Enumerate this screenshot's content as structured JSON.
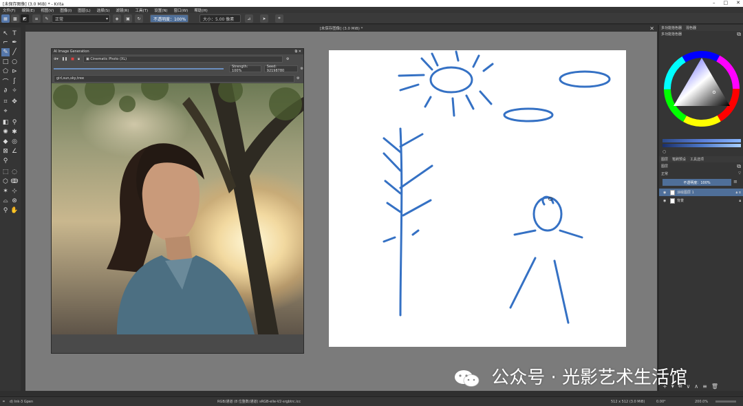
{
  "window": {
    "title": "[未保存图像] (3.0 MiB) * - Krita",
    "controls": [
      "–",
      "□",
      "✕"
    ]
  },
  "menubar": [
    "文件(F)",
    "编辑(E)",
    "视图(V)",
    "图像(I)",
    "图层(L)",
    "选择(S)",
    "滤镜(R)",
    "工具(T)",
    "设置(N)",
    "窗口(W)",
    "帮助(H)"
  ],
  "toolbar": {
    "blend_mode": "正常",
    "opacity": "不透明度：100%",
    "size": "大小：5.00 像素"
  },
  "document_tab": "[未保存图像] (3.0 MiB) *",
  "ai_panel": {
    "title": "AI Image Generation",
    "style": "Cinematic Photo (XL)",
    "strength": "Strength: 100%",
    "seed": "Seed: 92198780",
    "prompt": "girl,sun,sky,tree"
  },
  "right_dock": {
    "color_tabs": [
      "多功能拾色器",
      "混色器"
    ],
    "color_subtab": "多功能拾色器",
    "layer_tabs": [
      "图层",
      "笔刷预设",
      "工具选项"
    ],
    "layer_header": "图层",
    "blend_mode": "正常",
    "opacity": "不透明度：100%",
    "layers": [
      "涂绘图层 1",
      "背景"
    ]
  },
  "status": {
    "brush": "d) Ink-3 Gpen",
    "color_profile": "RGB/通道 (8 位整数/通道)  sRGB-elle-V2-srgbtrc.icc",
    "size": "512 x 512 (3.0 MiB)",
    "rotation": "0.00°",
    "zoom": "200.0%"
  },
  "watermark": "公众号 · 光影艺术生活馆",
  "colors": {
    "accent": "#4f6f99",
    "stroke": "#3571c4"
  }
}
